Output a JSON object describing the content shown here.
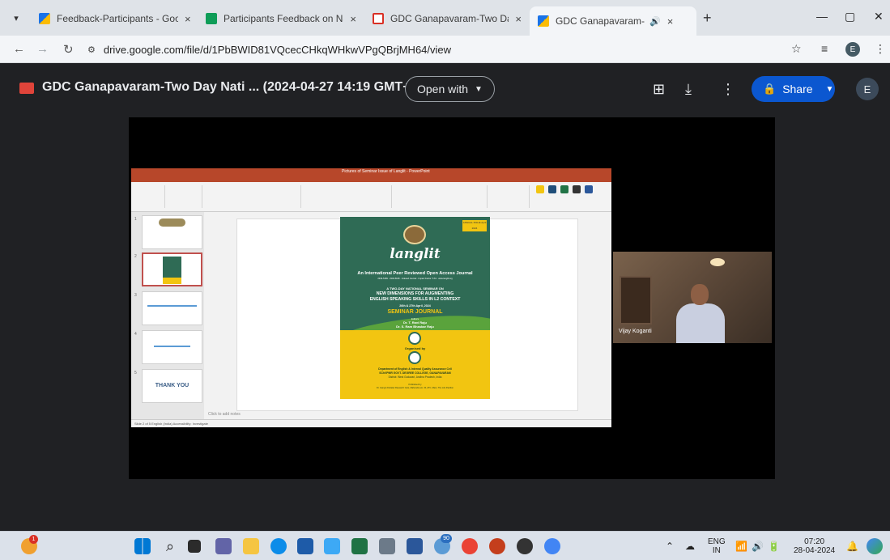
{
  "browser": {
    "tabs": [
      {
        "title": "Feedback-Participants - Google",
        "close": "×"
      },
      {
        "title": "Participants Feedback on Natio",
        "close": "×"
      },
      {
        "title": "GDC Ganapavaram-Two Day Na",
        "close": "×"
      },
      {
        "title": "GDC Ganapavaram-Two Da",
        "close": "×"
      }
    ],
    "new_tab": "+",
    "url": "drive.google.com/file/d/1PbBWID81VQcecCHkqWHkwVPgQBrjMH64/view",
    "profile_initial": "E",
    "window_controls": {
      "minimize": "—",
      "maximize": "▢",
      "close": "✕"
    }
  },
  "viewer": {
    "file_title": "GDC Ganapavaram-Two Day Nati ... (2024-04-27 14:19 GMT+5:30)",
    "open_with_label": "Open with",
    "share_label": "Share",
    "account_initial": "E"
  },
  "ppt": {
    "window_title": "Pictures of Seminar Issue of Langlit - PowerPoint",
    "thumb_thank_you": "THANK YOU",
    "notes_placeholder": "Click to add notes",
    "status_text": "Slide 2 of 5   English (India)   Accessibility: Investigate",
    "slide": {
      "badge": "ANNUAL ISSUE April 2024",
      "journal_name": "langlit",
      "subtitle": "An International Peer Reviewed Open Access Journal",
      "issn_line": "2349-5189 · 2349-5189 · Indexed Journal · Impact Factor: 5.61 · www.langlit.org",
      "seminar_line1": "A TWO-DAY NATIONAL SEMINAR ON",
      "seminar_line2": "NEW DIMENSIONS FOR AUGMENTING",
      "seminar_line3": "ENGLISH SPEAKING SKILLS IN L2 CONTEXT",
      "dates": "26th & 27th April, 2024",
      "seminar_journal": "SEMINAR JOURNAL",
      "editors_label": "Editors",
      "editor1": "Dr. T. Ravi Raju",
      "editor2": "Dr. S. Ram Bhaskar Raju",
      "organised_by": "Organised by",
      "dept_line": "Department of English & Internal Quality Assurance Cell",
      "college_line": "SChVPMR GOVT. DEGREE COLLEGE, GANAPAVARAM",
      "district_line": "District: West Godavari, Andhra Pradesh, India",
      "publisher_label": "Published by",
      "publisher_line": "Dr. Gangin Dubalar Research Cats, Mahendra etc. M, ATC, Main, The Life Pavilion"
    }
  },
  "camera": {
    "participant_name": "Vijay Koganti"
  },
  "taskbar": {
    "lang_top": "ENG",
    "lang_bottom": "IN",
    "time": "07:20",
    "date": "28-04-2024",
    "badge_count": "90",
    "weather_badge": "1"
  }
}
